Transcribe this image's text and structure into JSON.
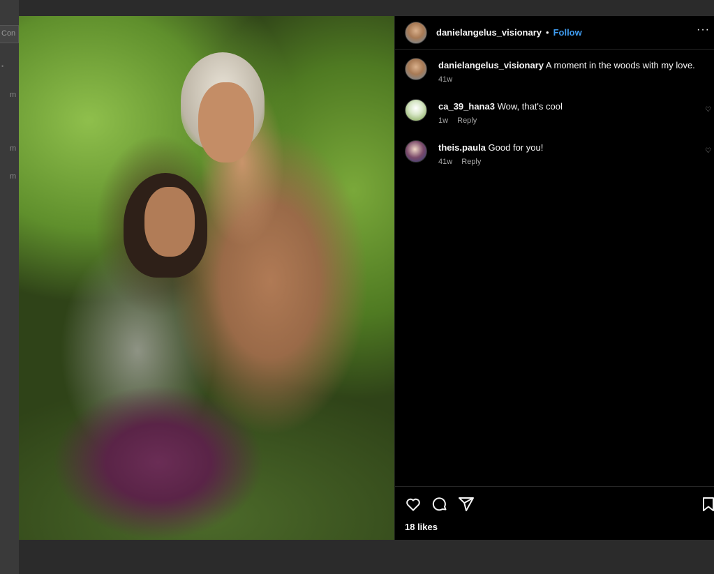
{
  "background": {
    "partial_button": "Con",
    "partial_marks": [
      "m",
      "m",
      "m"
    ]
  },
  "post": {
    "author": "danielangelus_visionary",
    "follow_label": "Follow",
    "separator": "•",
    "more_label": "···",
    "caption": {
      "username": "danielangelus_visionary",
      "text": "A moment in the woods with my love.",
      "age": "41w"
    },
    "comments": [
      {
        "username": "ca_39_hana3",
        "text": "Wow, that's cool",
        "age": "1w",
        "reply_label": "Reply"
      },
      {
        "username": "theis.paula",
        "text": "Good for you!",
        "age": "41w",
        "reply_label": "Reply"
      }
    ],
    "likes": "18 likes"
  },
  "colors": {
    "accent": "#3f9cf0",
    "panel_bg": "#000000",
    "overlay_bg": "#2b2b2b",
    "muted_text": "#a8a8a8"
  },
  "icons": {
    "like": "heart-icon",
    "comment": "comment-bubble-icon",
    "share": "paper-plane-icon",
    "save": "bookmark-icon"
  }
}
